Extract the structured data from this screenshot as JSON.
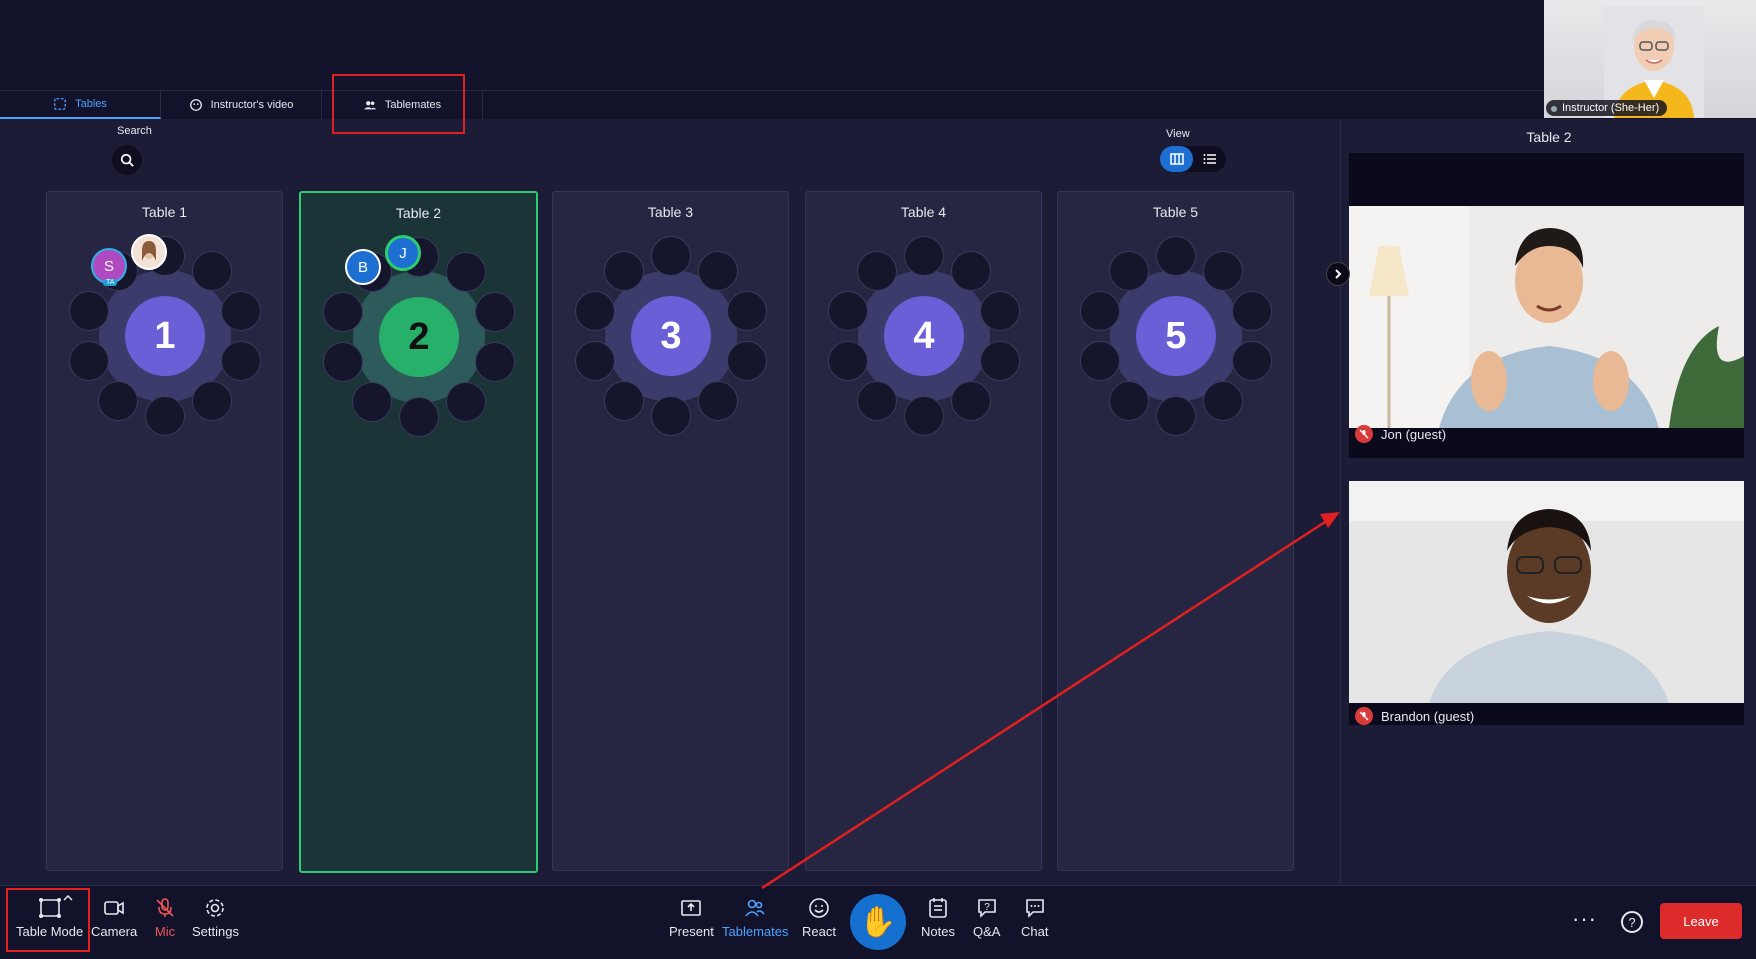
{
  "instructor": {
    "label": "Instructor (She-Her)"
  },
  "tabs": [
    {
      "label": "Tables",
      "icon": "table-mode-icon",
      "active": true
    },
    {
      "label": "Instructor's video",
      "icon": "face-icon",
      "active": false
    },
    {
      "label": "Tablemates",
      "icon": "people-icon",
      "active": false
    }
  ],
  "search": {
    "label": "Search"
  },
  "view": {
    "label": "View"
  },
  "tables": [
    {
      "title": "Table 1",
      "number": "1"
    },
    {
      "title": "Table 2",
      "number": "2"
    },
    {
      "title": "Table 3",
      "number": "3"
    },
    {
      "title": "Table 4",
      "number": "4"
    },
    {
      "title": "Table 5",
      "number": "5"
    }
  ],
  "table1_seats": {
    "s_initial": "S",
    "ta_badge": "TA"
  },
  "table2_seats": {
    "b_initial": "B",
    "j_initial": "J"
  },
  "side_panel": {
    "title": "Table 2",
    "participants": [
      {
        "name": "Jon (guest)",
        "muted": true
      },
      {
        "name": "Brandon (guest)",
        "muted": true
      }
    ]
  },
  "bottom": {
    "table_mode": "Table Mode",
    "camera": "Camera",
    "mic": "Mic",
    "settings": "Settings",
    "present": "Present",
    "tablemates": "Tablemates",
    "react": "React",
    "notes": "Notes",
    "qa": "Q&A",
    "chat": "Chat",
    "leave": "Leave",
    "help": "?",
    "more": "···"
  },
  "colors": {
    "accent": "#4da3ff",
    "selected": "#2ecc71",
    "hub": "#6a5fd6",
    "leave": "#dd2a2a",
    "highlight": "#e02020"
  }
}
